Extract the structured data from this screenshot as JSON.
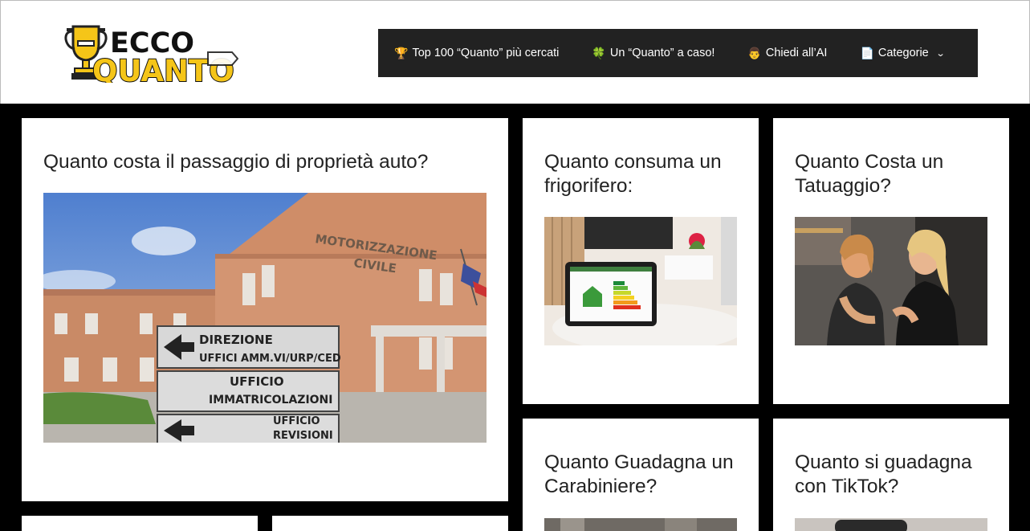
{
  "site": {
    "logo_line1": "ECCO",
    "logo_line2": "QUANTO"
  },
  "nav": {
    "items": [
      {
        "icon": "trophy-icon",
        "emoji": "🏆",
        "label": "Top 100 “Quanto” più cercati"
      },
      {
        "icon": "clover-icon",
        "emoji": "🍀",
        "label": "Un “Quanto” a caso!"
      },
      {
        "icon": "person-icon",
        "emoji": "👨",
        "label": "Chiedi all’AI"
      },
      {
        "icon": "page-icon",
        "emoji": "📄",
        "label": "Categorie",
        "dropdown_icon": "chevron-down-icon"
      }
    ]
  },
  "posts": [
    {
      "title": "Quanto costa il passaggio di proprietà auto?",
      "image_text": [
        "MOTORIZZAZIONE",
        "CIVILE",
        "DIREZIONE",
        "UFFICI AMM.VI/URP/CED",
        "UFFICIO",
        "IMMATRICOLAZIONI",
        "UFFICIO",
        "REVISIONI"
      ]
    },
    {
      "title": "Quanto consuma un frigorifero:"
    },
    {
      "title": "Quanto Costa un Tatuaggio?"
    },
    {
      "title": "Quanto Guadagna un Carabiniere?"
    },
    {
      "title": "Quanto si guadagna con TikTok?"
    }
  ],
  "colors": {
    "brand_yellow": "#f5c518",
    "nav_bg": "#222222",
    "page_bg": "#000000"
  }
}
